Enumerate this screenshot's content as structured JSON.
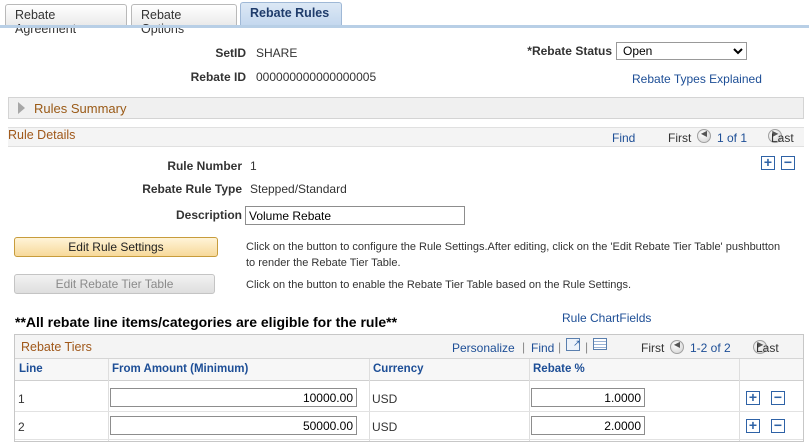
{
  "tabs": [
    {
      "label": "Rebate Agreement",
      "active": false
    },
    {
      "label": "Rebate Options",
      "active": false
    },
    {
      "label": "Rebate Rules",
      "active": true
    }
  ],
  "header": {
    "setid_label": "SetID",
    "setid_value": "SHARE",
    "rebate_id_label": "Rebate ID",
    "rebate_id_value": "000000000000000005",
    "rebate_status_label": "*Rebate Status",
    "rebate_status_value": "Open",
    "rebate_types_link": "Rebate Types Explained"
  },
  "rules_summary": {
    "title": "Rules Summary"
  },
  "rule_details": {
    "title": "Rule Details",
    "find": "Find",
    "first": "First",
    "range": "1 of 1",
    "last": "Last",
    "rule_number_label": "Rule Number",
    "rule_number_value": "1",
    "rule_type_label": "Rebate Rule Type",
    "rule_type_value": "Stepped/Standard",
    "description_label": "Description",
    "description_value": "Volume Rebate"
  },
  "buttons": {
    "edit_rule_settings": "Edit Rule Settings",
    "edit_rule_settings_help": "Click on the button to configure the Rule Settings.After editing, click on the 'Edit Rebate Tier Table' pushbutton to render the Rebate Tier Table.",
    "edit_tier_table": "Edit Rebate Tier Table",
    "edit_tier_table_help": "Click on the button to enable the Rebate Tier Table based on the Rule Settings."
  },
  "eligibility_note": "**All rebate line items/categories are eligible for the rule**",
  "rule_chartfields_link": "Rule ChartFields",
  "tiers": {
    "title": "Rebate Tiers",
    "personalize": "Personalize",
    "find": "Find",
    "first": "First",
    "range": "1-2 of 2",
    "last": "Last",
    "columns": [
      "Line",
      "From Amount (Minimum)",
      "Currency",
      "Rebate %"
    ],
    "rows": [
      {
        "line": "1",
        "from_amount": "10000.00",
        "currency": "USD",
        "rebate_pct": "1.0000"
      },
      {
        "line": "2",
        "from_amount": "50000.00",
        "currency": "USD",
        "rebate_pct": "2.0000"
      }
    ]
  },
  "icons": {
    "collapsed_arrow": "triangle-right-icon",
    "prev": "prev-circle-icon",
    "next": "next-circle-icon",
    "add": "plus-icon",
    "remove": "minus-icon",
    "view_all": "expand-window-icon",
    "download": "grid-download-icon"
  },
  "colors": {
    "link": "#1d4e96",
    "section_title": "#a0581a",
    "active_button": "#f7d99a",
    "active_tab": "#c3d7ee"
  }
}
